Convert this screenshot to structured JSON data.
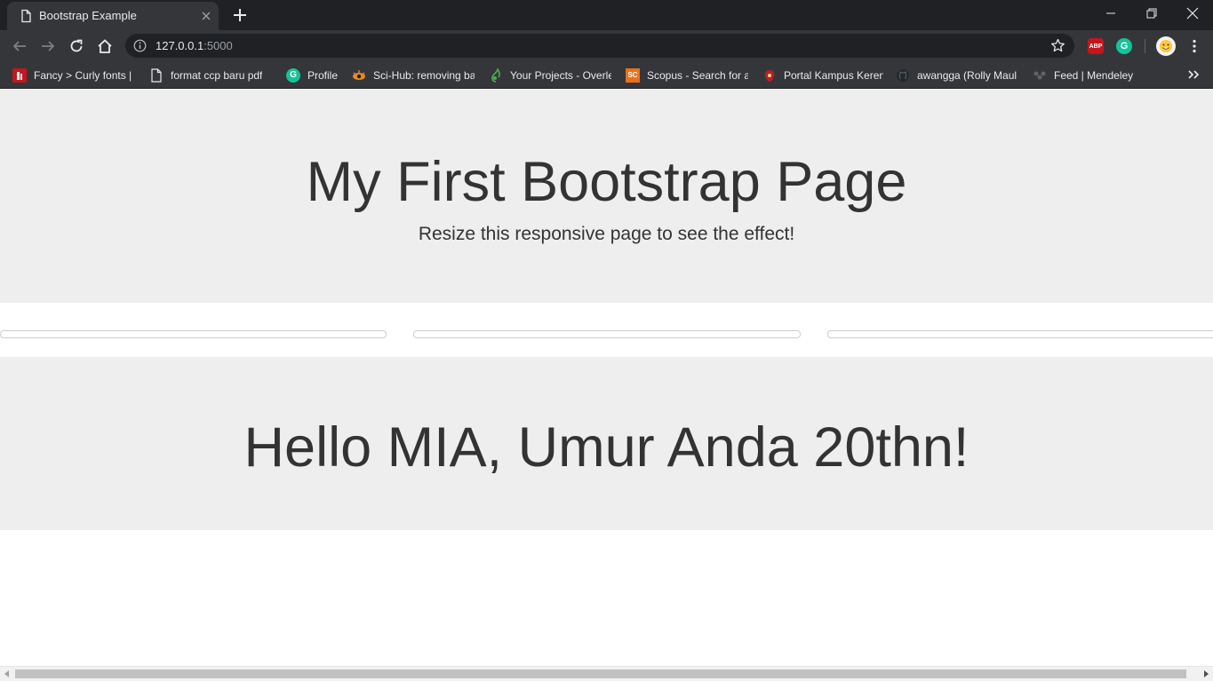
{
  "browser": {
    "tab_title": "Bootstrap Example",
    "url_host": "127.0.0.1",
    "url_port": ":5000",
    "bookmarks": [
      {
        "label": "Fancy > Curly fonts |",
        "icon": "fancy-icon"
      },
      {
        "label": "format ccp baru pdf",
        "icon": "page-icon"
      },
      {
        "label": "Profile",
        "icon": "grammarly-icon"
      },
      {
        "label": "Sci-Hub: removing ba",
        "icon": "scihub-icon"
      },
      {
        "label": "Your Projects - Overle",
        "icon": "overleaf-icon"
      },
      {
        "label": "Scopus - Search for a",
        "icon": "scopus-icon"
      },
      {
        "label": "Portal Kampus Keren",
        "icon": "portal-icon"
      },
      {
        "label": "awangga (Rolly Maul",
        "icon": "github-icon"
      },
      {
        "label": "Feed | Mendeley",
        "icon": "mendeley-icon"
      }
    ],
    "colors": {
      "titlebar": "#202124",
      "toolbar": "#35363a",
      "abp": "#c4161c",
      "grammarly": "#15c39a"
    }
  },
  "page": {
    "jumbotron_title": "My First Bootstrap Page",
    "jumbotron_subtitle": "Resize this responsive page to see the effect!",
    "greeting": "Hello MIA, Umur Anda 20thn!",
    "colors": {
      "jumbotron_bg": "#eeeeee",
      "text": "#333333"
    }
  }
}
